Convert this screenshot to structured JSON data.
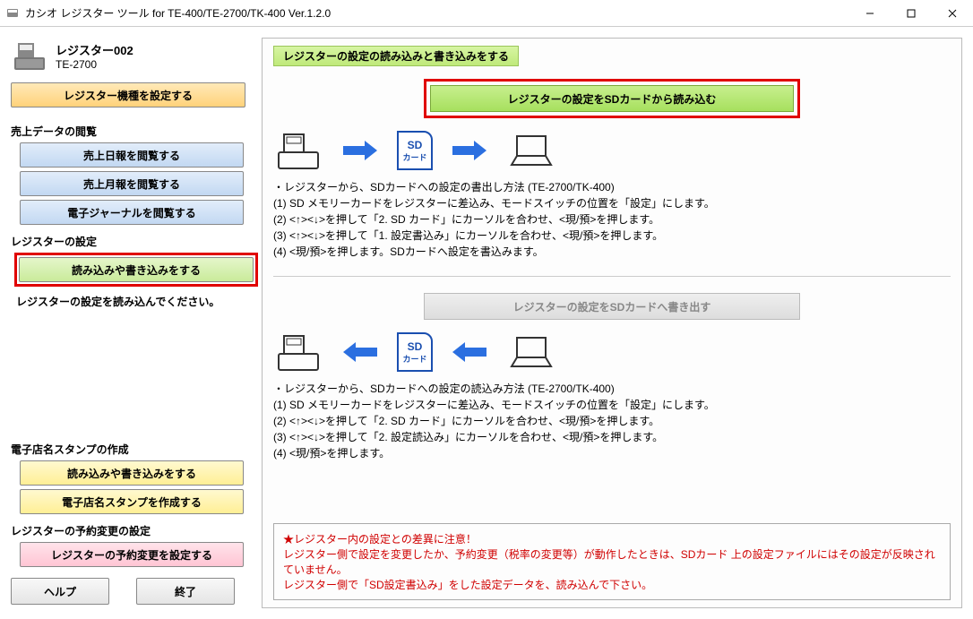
{
  "window": {
    "title": "カシオ レジスター ツール for TE-400/TE-2700/TK-400 Ver.1.2.0"
  },
  "device": {
    "name": "レジスター002",
    "model": "TE-2700"
  },
  "sidebar": {
    "btn_configure": "レジスター機種を設定する",
    "group_sales": "売上データの閲覧",
    "btn_daily": "売上日報を閲覧する",
    "btn_monthly": "売上月報を閲覧する",
    "btn_journal": "電子ジャーナルを閲覧する",
    "group_settings": "レジスターの設定",
    "btn_rw": "読み込みや書き込みをする",
    "instruction": "レジスターの設定を読み込んでください。",
    "group_stamp": "電子店名スタンプの作成",
    "btn_stamp_rw": "読み込みや書き込みをする",
    "btn_stamp_create": "電子店名スタンプを作成する",
    "group_reserve": "レジスターの予約変更の設定",
    "btn_reserve": "レジスターの予約変更を設定する",
    "btn_help": "ヘルプ",
    "btn_exit": "終了"
  },
  "main": {
    "title": "レジスターの設定の読み込みと書き込みをする",
    "btn_read": "レジスターの設定をSDカードから読み込む",
    "sd_label_top": "SD",
    "sd_label_bottom": "カード",
    "notes_read": "・レジスターから、SDカードへの設定の書出し方法 (TE-2700/TK-400)\n(1) SD メモリーカードをレジスターに差込み、モードスイッチの位置を「設定」にします。\n(2) <↑><↓>を押して「2. SD カード」にカーソルを合わせ、<現/預>を押します。\n(3) <↑><↓>を押して「1. 設定書込み」にカーソルを合わせ、<現/預>を押します。\n(4) <現/預>を押します。SDカードへ設定を書込みます。",
    "btn_write": "レジスターの設定をSDカードへ書き出す",
    "notes_write": "・レジスターから、SDカードへの設定の読込み方法 (TE-2700/TK-400)\n(1) SD メモリーカードをレジスターに差込み、モードスイッチの位置を「設定」にします。\n(2) <↑><↓>を押して「2. SD カード」にカーソルを合わせ、<現/預>を押します。\n(3) <↑><↓>を押して「2. 設定読込み」にカーソルを合わせ、<現/預>を押します。\n(4) <現/預>を押します。",
    "warning": "★レジスター内の設定との差異に注意！\nレジスター側で設定を変更したか、予約変更（税率の変更等）が動作したときは、SDカード 上の設定ファイルにはその設定が反映されていません。\nレジスター側で「SD設定書込み」をした設定データを、読み込んで下さい。"
  }
}
